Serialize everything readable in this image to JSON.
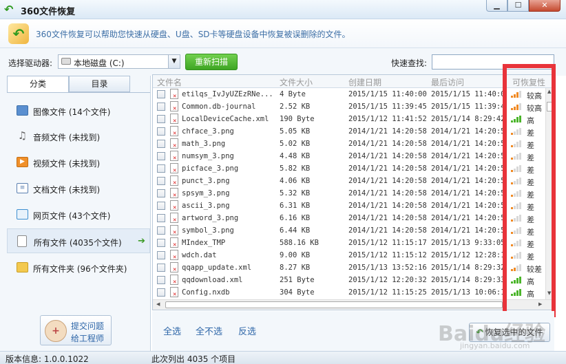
{
  "window": {
    "title": "360文件恢复",
    "min_icon": "minimize-icon",
    "max_icon": "maximize-icon",
    "close_icon": "close-icon"
  },
  "banner": {
    "text": "360文件恢复可以帮助您快速从硬盘、U盘、SD卡等硬盘设备中恢复被误删除的文件。"
  },
  "toolbar": {
    "drive_label": "选择驱动器:",
    "drive_value": "本地磁盘 (C:)",
    "rescan_label": "重新扫描",
    "quick_find_label": "快速查找:",
    "quick_find_value": ""
  },
  "sidebar": {
    "tabs": [
      "分类",
      "目录"
    ],
    "categories": [
      {
        "label": "图像文件 (14个文件)",
        "icon": "image-icon",
        "color": "#5a8fd0"
      },
      {
        "label": "音频文件 (未找到)",
        "icon": "music-icon",
        "color": "#7a7a7a"
      },
      {
        "label": "视频文件 (未找到)",
        "icon": "video-icon",
        "color": "#f0902a"
      },
      {
        "label": "文档文件 (未找到)",
        "icon": "document-icon",
        "color": "#5a7fb0"
      },
      {
        "label": "网页文件 (43个文件)",
        "icon": "web-icon",
        "color": "#3d8fd0"
      },
      {
        "label": "所有文件 (4035个文件)",
        "icon": "file-icon",
        "color": "#ffffff",
        "selected": true
      },
      {
        "label": "所有文件夹 (96个文件夹)",
        "icon": "folder-icon",
        "color": "#f3c94f"
      }
    ],
    "support_line1": "提交问题",
    "support_line2": "给工程师"
  },
  "table": {
    "headers": {
      "name": "文件名",
      "size": "文件大小",
      "created": "创建日期",
      "accessed": "最后访问",
      "recoverability": "可恢复性"
    },
    "rows": [
      {
        "name": "etilqs_IvJyUZEzRNe...",
        "size": "4 Byte",
        "created": "2015/1/15 11:40:00",
        "accessed": "2015/1/15 11:40:0",
        "level": 3,
        "rec": "较高"
      },
      {
        "name": "Common.db-journal",
        "size": "2.52 KB",
        "created": "2015/1/15 11:39:45",
        "accessed": "2015/1/15 11:39:4",
        "level": 3,
        "rec": "较高"
      },
      {
        "name": "LocalDeviceCache.xml",
        "size": "190 Byte",
        "created": "2015/1/12 11:41:52",
        "accessed": "2015/1/14 8:29:42",
        "level": 4,
        "rec": "高"
      },
      {
        "name": "chface_3.png",
        "size": "5.05 KB",
        "created": "2014/1/21 14:20:58",
        "accessed": "2014/1/21 14:20:5",
        "level": 1,
        "rec": "差"
      },
      {
        "name": "math_3.png",
        "size": "5.02 KB",
        "created": "2014/1/21 14:20:58",
        "accessed": "2014/1/21 14:20:5",
        "level": 1,
        "rec": "差"
      },
      {
        "name": "numsym_3.png",
        "size": "4.48 KB",
        "created": "2014/1/21 14:20:58",
        "accessed": "2014/1/21 14:20:5",
        "level": 1,
        "rec": "差"
      },
      {
        "name": "picface_3.png",
        "size": "5.82 KB",
        "created": "2014/1/21 14:20:58",
        "accessed": "2014/1/21 14:20:5",
        "level": 1,
        "rec": "差"
      },
      {
        "name": "punct_3.png",
        "size": "4.06 KB",
        "created": "2014/1/21 14:20:58",
        "accessed": "2014/1/21 14:20:5",
        "level": 1,
        "rec": "差"
      },
      {
        "name": "spsym_3.png",
        "size": "5.32 KB",
        "created": "2014/1/21 14:20:58",
        "accessed": "2014/1/21 14:20:5",
        "level": 1,
        "rec": "差"
      },
      {
        "name": "ascii_3.png",
        "size": "6.31 KB",
        "created": "2014/1/21 14:20:58",
        "accessed": "2014/1/21 14:20:5",
        "level": 1,
        "rec": "差"
      },
      {
        "name": "artword_3.png",
        "size": "6.16 KB",
        "created": "2014/1/21 14:20:58",
        "accessed": "2014/1/21 14:20:5",
        "level": 1,
        "rec": "差"
      },
      {
        "name": "symbol_3.png",
        "size": "6.44 KB",
        "created": "2014/1/21 14:20:58",
        "accessed": "2014/1/21 14:20:5",
        "level": 1,
        "rec": "差"
      },
      {
        "name": "MIndex_TMP",
        "size": "588.16 KB",
        "created": "2015/1/12 11:15:17",
        "accessed": "2015/1/13 9:33:05",
        "level": 1,
        "rec": "差"
      },
      {
        "name": "wdch.dat",
        "size": "9.00 KB",
        "created": "2015/1/12 11:15:12",
        "accessed": "2015/1/12 12:28:1",
        "level": 1,
        "rec": "差"
      },
      {
        "name": "qqapp_update.xml",
        "size": "8.27 KB",
        "created": "2015/1/13 13:52:16",
        "accessed": "2015/1/14 8:29:32",
        "level": 2,
        "rec": "较差"
      },
      {
        "name": "qqdownload.xml",
        "size": "251 Byte",
        "created": "2015/1/12 12:20:32",
        "accessed": "2015/1/14 8:29:33",
        "level": 4,
        "rec": "高"
      },
      {
        "name": "Config.nxdb",
        "size": "304 Byte",
        "created": "2015/1/12 11:15:25",
        "accessed": "2015/1/13 10:06:1",
        "level": 4,
        "rec": "高"
      }
    ]
  },
  "actions": {
    "select_all": "全选",
    "select_none": "全不选",
    "invert": "反选",
    "recover_label": "恢复选中的文件"
  },
  "status": {
    "version": "版本信息: 1.0.0.1022",
    "count": "此次列出 4035 个项目"
  },
  "watermark": {
    "text": "Baidu经验",
    "sub": "jingyan.baidu.com"
  },
  "colors": {
    "accent_green": "#3ea523",
    "highlight_red": "#e8333a",
    "bar_orange": "#f08a24",
    "bar_green": "#4bb52a",
    "link_blue": "#2e66a8"
  }
}
